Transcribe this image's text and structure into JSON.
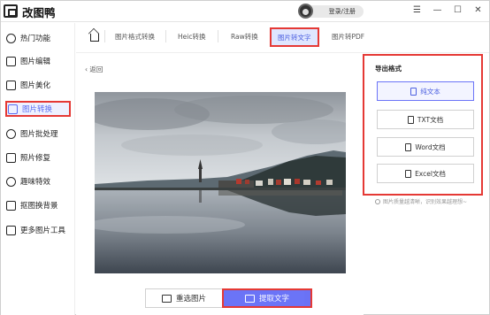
{
  "app": {
    "title": "改图鸭",
    "login_label": "登录/注册"
  },
  "window_controls": [
    "☰",
    "—",
    "☐",
    "✕"
  ],
  "sidebar": {
    "items": [
      {
        "label": "热门功能",
        "icon": "hot-icon"
      },
      {
        "label": "图片编辑",
        "icon": "image-edit-icon"
      },
      {
        "label": "图片美化",
        "icon": "image-beautify-icon"
      },
      {
        "label": "图片转换",
        "icon": "image-convert-icon",
        "active": true
      },
      {
        "label": "图片批处理",
        "icon": "batch-icon"
      },
      {
        "label": "照片修复",
        "icon": "photo-repair-icon"
      },
      {
        "label": "趣味特效",
        "icon": "effects-icon"
      },
      {
        "label": "抠图换背景",
        "icon": "cutout-icon"
      },
      {
        "label": "更多图片工具",
        "icon": "more-tools-icon"
      }
    ]
  },
  "tabs": [
    {
      "label": "图片格式转换"
    },
    {
      "label": "Heic转换"
    },
    {
      "label": "Raw转换"
    },
    {
      "label": "图片转文字",
      "active": true
    },
    {
      "label": "图片转PDF"
    }
  ],
  "content": {
    "back_label": "返回",
    "reselect_label": "重选图片",
    "extract_label": "提取文字"
  },
  "export": {
    "title": "导出格式",
    "options": [
      {
        "label": "纯文本",
        "active": true
      },
      {
        "label": "TXT文档"
      },
      {
        "label": "Word文档"
      },
      {
        "label": "Excel文档"
      }
    ],
    "note": "图片质量越清晰，识别效果越理想~"
  },
  "colors": {
    "accent": "#6b74f7",
    "highlight": "#e53935"
  }
}
